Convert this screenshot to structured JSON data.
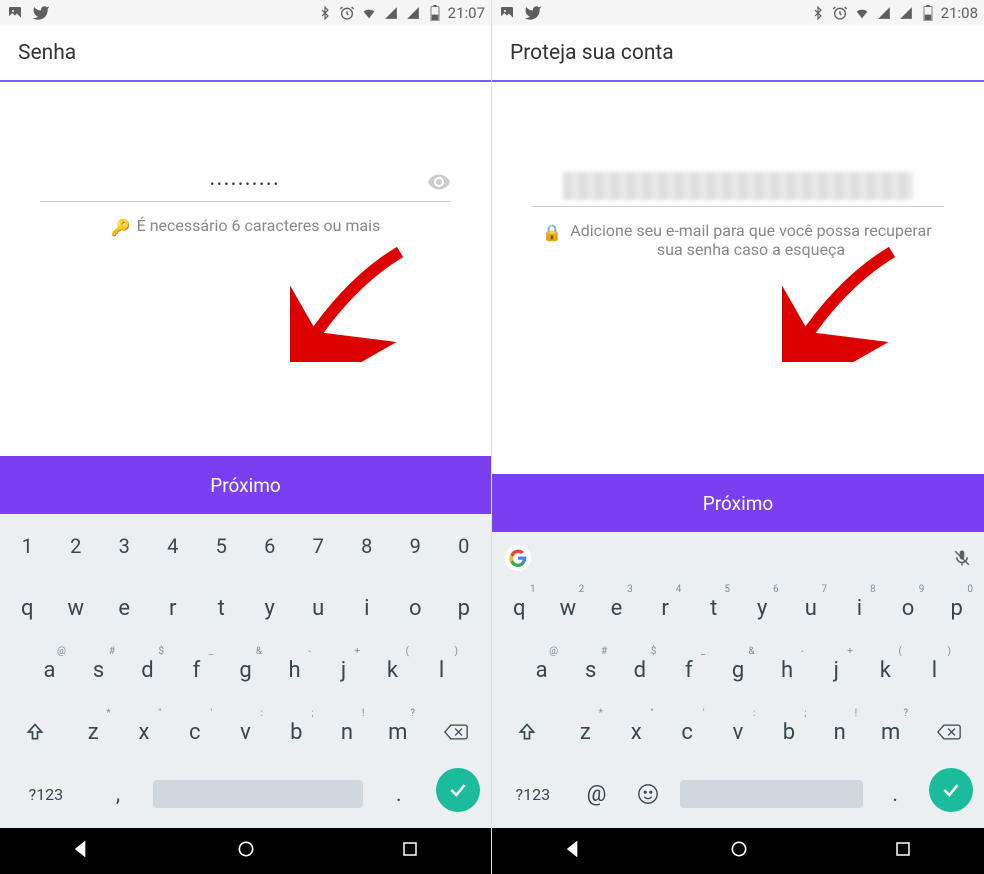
{
  "left": {
    "status_time": "21:07",
    "header_title": "Senha",
    "password_value": "••••••••••",
    "helper_text": "É necessário 6 caracteres ou mais",
    "next_label": "Próximo",
    "keyboard": {
      "row1": [
        "1",
        "2",
        "3",
        "4",
        "5",
        "6",
        "7",
        "8",
        "9",
        "0"
      ],
      "row2": [
        {
          "k": "q"
        },
        {
          "k": "w"
        },
        {
          "k": "e"
        },
        {
          "k": "r"
        },
        {
          "k": "t"
        },
        {
          "k": "y"
        },
        {
          "k": "u"
        },
        {
          "k": "i"
        },
        {
          "k": "o"
        },
        {
          "k": "p"
        }
      ],
      "row3": [
        {
          "k": "a",
          "s": "@"
        },
        {
          "k": "s",
          "s": "#"
        },
        {
          "k": "d",
          "s": "$"
        },
        {
          "k": "f",
          "s": "_"
        },
        {
          "k": "g",
          "s": "&"
        },
        {
          "k": "h",
          "s": "-"
        },
        {
          "k": "j",
          "s": "+"
        },
        {
          "k": "k",
          "s": "("
        },
        {
          "k": "l",
          "s": ")"
        }
      ],
      "row4": [
        {
          "k": "z",
          "s": "*"
        },
        {
          "k": "x",
          "s": "\""
        },
        {
          "k": "c",
          "s": "'"
        },
        {
          "k": "v",
          "s": ":"
        },
        {
          "k": "b",
          "s": ";"
        },
        {
          "k": "n",
          "s": "!"
        },
        {
          "k": "m",
          "s": "?"
        }
      ],
      "sym_label": "?123",
      "comma": ",",
      "period": "."
    }
  },
  "right": {
    "status_time": "21:08",
    "header_title": "Proteja sua conta",
    "helper_text": "Adicione seu e-mail para que você possa recuperar sua senha caso a esqueça",
    "next_label": "Próximo",
    "keyboard": {
      "row2": [
        {
          "k": "q",
          "s": "1"
        },
        {
          "k": "w",
          "s": "2"
        },
        {
          "k": "e",
          "s": "3"
        },
        {
          "k": "r",
          "s": "4"
        },
        {
          "k": "t",
          "s": "5"
        },
        {
          "k": "y",
          "s": "6"
        },
        {
          "k": "u",
          "s": "7"
        },
        {
          "k": "i",
          "s": "8"
        },
        {
          "k": "o",
          "s": "9"
        },
        {
          "k": "p",
          "s": "0"
        }
      ],
      "row3": [
        {
          "k": "a",
          "s": "@"
        },
        {
          "k": "s",
          "s": "#"
        },
        {
          "k": "d",
          "s": "$"
        },
        {
          "k": "f",
          "s": "_"
        },
        {
          "k": "g",
          "s": "&"
        },
        {
          "k": "h",
          "s": "-"
        },
        {
          "k": "j",
          "s": "+"
        },
        {
          "k": "k",
          "s": "("
        },
        {
          "k": "l",
          "s": ")"
        }
      ],
      "row4": [
        {
          "k": "z",
          "s": "*"
        },
        {
          "k": "x",
          "s": "\""
        },
        {
          "k": "c",
          "s": "'"
        },
        {
          "k": "v",
          "s": ":"
        },
        {
          "k": "b",
          "s": ";"
        },
        {
          "k": "n",
          "s": "!"
        },
        {
          "k": "m",
          "s": "?"
        }
      ],
      "sym_label": "?123",
      "at": "@",
      "period": "."
    }
  }
}
